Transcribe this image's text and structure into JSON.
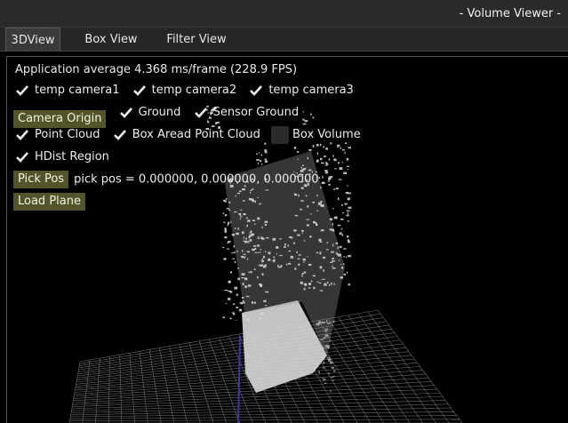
{
  "window": {
    "title": "- Volume Viewer -"
  },
  "tabs": [
    {
      "label": "3DView",
      "active": true
    },
    {
      "label": "Box View",
      "active": false
    },
    {
      "label": "Filter View",
      "active": false
    }
  ],
  "panel": {
    "fps_text": "Application average 4.368 ms/frame (228.9 FPS)",
    "cameras": [
      {
        "label": "temp camera1",
        "checked": true
      },
      {
        "label": "temp camera2",
        "checked": true
      },
      {
        "label": "temp camera3",
        "checked": true
      }
    ],
    "camera_origin_button": "Camera Origin",
    "ground": {
      "label": "Ground",
      "checked": true
    },
    "sensor_ground": {
      "label": "Sensor Ground",
      "checked": true
    },
    "point_cloud": {
      "label": "Point Cloud",
      "checked": true
    },
    "box_aread_point_cloud": {
      "label": "Box Aread Point Cloud",
      "checked": true
    },
    "box_volume": {
      "label": "Box Volume",
      "checked": false
    },
    "hdist_region": {
      "label": "HDist Region",
      "checked": true
    },
    "pick_pos_button": "Pick Pos",
    "pick_pos_text": "pick pos = 0.000000, 0.000000, 0.000000",
    "load_plane_button": "Load Plane"
  },
  "colors": {
    "button_bg": "#54542a",
    "grid_line": "#8a8a8a",
    "point_cloud": "#d8d8d8",
    "axis_line": "#3a3aa0"
  }
}
